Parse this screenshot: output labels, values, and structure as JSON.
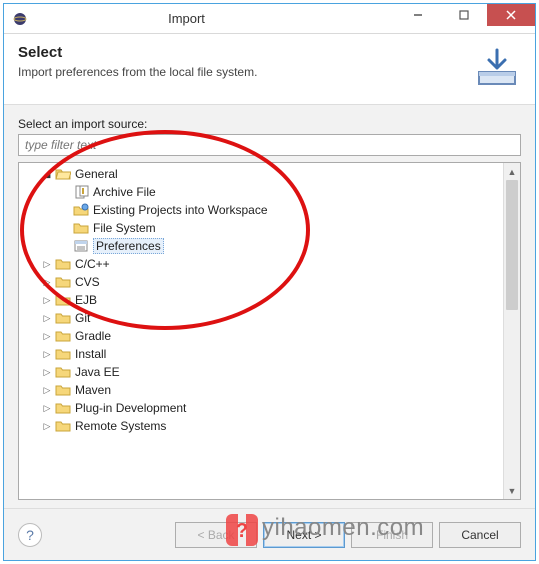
{
  "window": {
    "title": "Import"
  },
  "header": {
    "title": "Select",
    "description": "Import preferences from the local file system."
  },
  "source": {
    "label": "Select an import source:",
    "filter_placeholder": "type filter text"
  },
  "tree": {
    "general": {
      "label": "General",
      "children": {
        "archive": "Archive File",
        "existing": "Existing Projects into Workspace",
        "filesystem": "File System",
        "preferences": "Preferences"
      }
    },
    "cats": {
      "cpp": "C/C++",
      "cvs": "CVS",
      "ejb": "EJB",
      "git": "Git",
      "gradle": "Gradle",
      "install": "Install",
      "javaee": "Java EE",
      "maven": "Maven",
      "plugin": "Plug-in Development",
      "remote": "Remote Systems"
    }
  },
  "buttons": {
    "back": "< Back",
    "next": "Next >",
    "finish": "Finish",
    "cancel": "Cancel"
  },
  "watermark": "yihaomen.com"
}
